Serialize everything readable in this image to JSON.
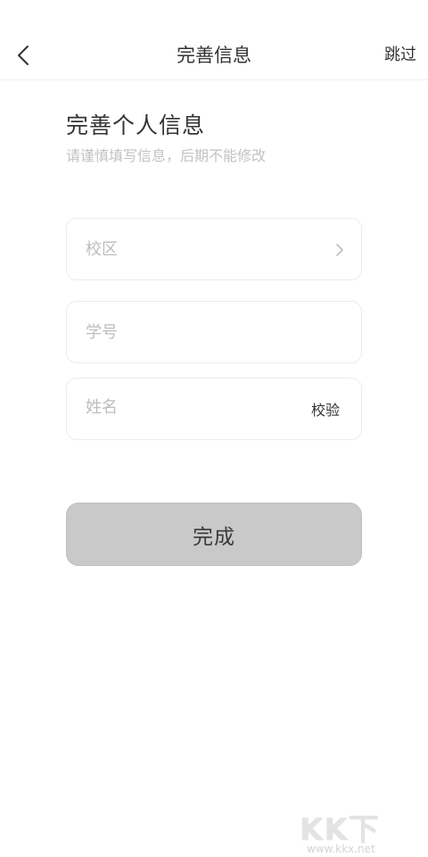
{
  "nav": {
    "title": "完善信息",
    "skip_label": "跳过",
    "back_icon": "chevron-left-icon"
  },
  "header": {
    "title": "完善个人信息",
    "subtitle": "请谨慎填写信息，后期不能修改"
  },
  "form": {
    "campus_placeholder": "校区",
    "student_id_placeholder": "学号",
    "name_placeholder": "姓名",
    "verify_label": "校验",
    "campus_chevron_icon": "chevron-right-icon"
  },
  "submit": {
    "label": "完成"
  },
  "watermark": {
    "logo_text": "KK下载",
    "url": "www.kkx.net"
  },
  "colors": {
    "background": "#ffffff",
    "text_primary": "#333333",
    "placeholder": "#bdbdbd",
    "subtitle": "#c2c2c2",
    "button_disabled": "#c9c9c9",
    "field_border": "#ececec"
  }
}
